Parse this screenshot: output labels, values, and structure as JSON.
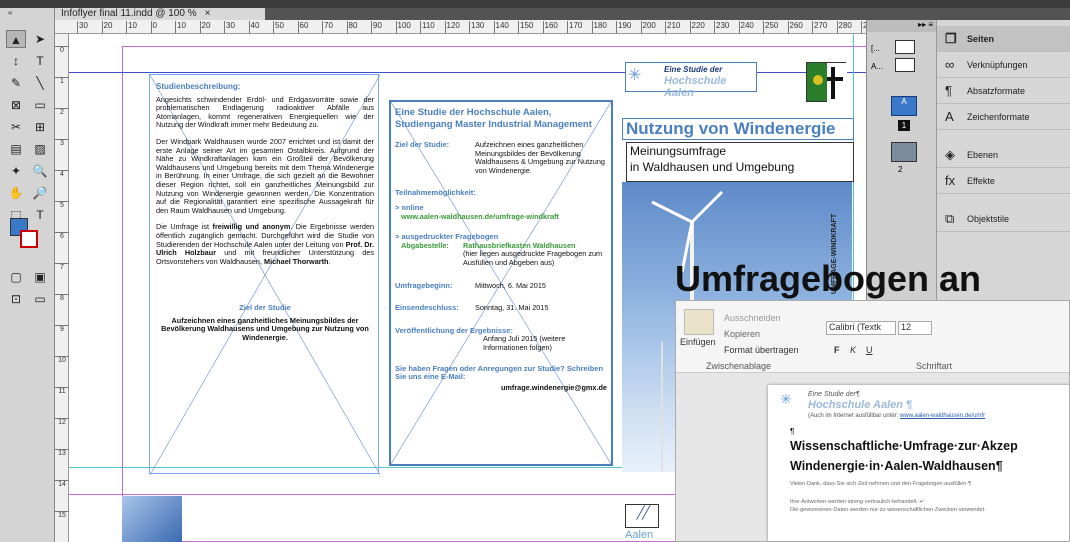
{
  "document_tab": {
    "title": "Infoflyer final 11.indd @ 100 %",
    "close": "×"
  },
  "ruler_numbers": [
    "30",
    "20",
    "10",
    "0",
    "10",
    "20",
    "30",
    "40",
    "50",
    "60",
    "70",
    "80",
    "90",
    "100",
    "110",
    "120",
    "130",
    "140",
    "150",
    "160",
    "170",
    "180",
    "190",
    "200",
    "210",
    "220",
    "230",
    "240",
    "250",
    "260",
    "270",
    "280",
    "290"
  ],
  "vruler_numbers": [
    "0",
    "1",
    "2",
    "3",
    "4",
    "5",
    "6",
    "7",
    "8",
    "9",
    "10",
    "11",
    "12",
    "13",
    "14",
    "15"
  ],
  "toolbox": {
    "collapse": "«",
    "tools": [
      "▲",
      "➤",
      "↕",
      "T",
      "✎",
      "╲",
      "⊠",
      "▭",
      "✂",
      "⊞",
      "▤",
      "▨",
      "✦",
      "🔍",
      "✋",
      "🔎",
      "⬚",
      "T",
      "▢",
      "▣",
      "⊡",
      "▭"
    ]
  },
  "left_column": {
    "heading": "Studienbeschreibung:",
    "p1": "Angesichts schwindender Erdöl- und Erdgasvorräte sowie der problematischen Endlagerung radioaktiver Abfälle aus Atomanlagen, kommt regenerativen Energiequellen wie der Nutzung der Windkraft immer mehr Bedeutung zu.",
    "p2": "Der Windpark Waldhausen wurde 2007 errichtet und ist damit der erste Anlage seiner Art im gesamten Ostalbkreis. Aufgrund der Nähe zu Windkraftanlagen kam ein Großteil der Bevölkerung Waldhausens und Umgebung bereits mit dem Thema Windenergie in Berührung. In einer Umfrage, die sich gezielt an die Bewohner dieser Region richtet, soll ein ganzheitliches Meinungsbild zur Nutzung von Windenergie gewonnen werden. Die Konzentration auf die Regionalität garantiert eine spezifische Aussagekraft für den Raum Waldhausen und Umgebung.",
    "p3_a": "Die Umfrage ist ",
    "p3_bold": "freiwillig und anonym",
    "p3_b": ". Die Ergebnisse werden öffentlich zugänglich gemacht. Durchgeführt wird die Studie von Studierenden der Hochschule Aalen unter der Leitung von ",
    "p3_bold2": "Prof. Dr. Ulrich Holzbaur",
    "p3_c": " und mit freundlicher Unterstützung des Ortsvorstehers von Waldhausen, ",
    "p3_bold3": "Michael Thorwarth",
    "p3_d": ".",
    "ziel_heading": "Ziel der Studie",
    "ziel_text": "Aufzeichnen eines ganzheitliches Meinungsbildes der Bevölkerung Waldhausens und Umgebung zur Nutzung von Windenergie."
  },
  "middle_column": {
    "heading": "Eine Studie der Hochschule Aalen, Studiengang Master Industrial Management",
    "ziel_label": "Ziel der Studie:",
    "ziel_value": "Aufzeichnen eines ganzheitlichen Meinungsbildes der Bevölkerung Waldhausens & Umgebung zur Nutzung von Windenergie.",
    "teilnahme": "Teilnahmemöglichkeit:",
    "online_label": "> online",
    "online_url": "www.aalen-waldhausen.de/umfrage-windkraft",
    "print_label": "> ausgedruckter Fragebogen",
    "abgabe_label": "Abgabestelle:",
    "abgabe_value": "Rathausbriefkasten Waldhausen",
    "abgabe_note": "(hier liegen ausgedruckte Fragebogen zum Ausfüllen und Abgeben aus)",
    "beginn_label": "Umfragebeginn:",
    "beginn_value": "Mittwoch, 6. Mai 2015",
    "schluss_label": "Einsendeschluss:",
    "schluss_value": "Sonntag, 31. Mai 2015",
    "veroeff_label": "Veröffentlichung der Ergebnisse:",
    "veroeff_value": "Anfang Juli 2015 (weitere Informationen folgen)",
    "fragen": "Sie haben Fragen oder Anregungen zur Studie? Schreiben Sie uns eine E-Mail:",
    "email": "umfrage.windenergie@gmx.de"
  },
  "right_column": {
    "logo_line1": "Eine Studie der",
    "logo_line2": "Hochschule Aalen",
    "title": "Nutzung von Windenergie",
    "sub1": "Meinungsumfrage",
    "sub2": "in Waldhausen und Umgebung",
    "vertical": "UMFRAGE-WINDKRAFT",
    "bottom_logo": "Aalen"
  },
  "pages_panel": {
    "label_a": "A",
    "label_b": "[...",
    "label_c": "A...",
    "page1": "1",
    "page2": "2"
  },
  "properties": {
    "items": [
      "Seiten",
      "Verknüpfungen",
      "Absatzformate",
      "Zeichenformate",
      "Ebenen",
      "Effekte",
      "Objektstile"
    ],
    "icons": [
      "❐",
      "∞",
      "¶",
      "A",
      "◈",
      "fx",
      "⧉"
    ]
  },
  "overlay_banner": "Umfragebogen an",
  "word": {
    "ausschneiden": "Ausschneiden",
    "kopieren": "Kopieren",
    "einfuegen": "Einfügen",
    "format": "Format übertragen",
    "zwischenablage": "Zwischenablage",
    "font": "Calibri (Textk",
    "size": "12",
    "schriftart": "Schriftart",
    "bold": "F",
    "italic": "K",
    "under": "U",
    "doc_logo1": "Eine Studie der¶",
    "doc_logo2": "Hochschule Aalen ¶",
    "doc_link_a": "(Auch im Internet ausfüllbar unter: ",
    "doc_link": "www.aalen-waldhausen.de/umfr",
    "pilcrow": "¶",
    "doc_title1": "Wissenschaftliche·Umfrage·zur·Akzep",
    "doc_title2": "Windenergie·in·Aalen-Waldhausen¶",
    "thanks": "Vielen·Dank,·dass·Sie·sich·Zeit·nehmen·und·den·Fragebogen·ausfüllen·¶",
    "note1": "Ihre·Antworten·werden·streng·vertraulich·behandelt.·↵",
    "note2": "Die·gewonnenen·Daten·werden·nur·zu·wissenschaftlichen·Zwecken·verwendet·"
  }
}
